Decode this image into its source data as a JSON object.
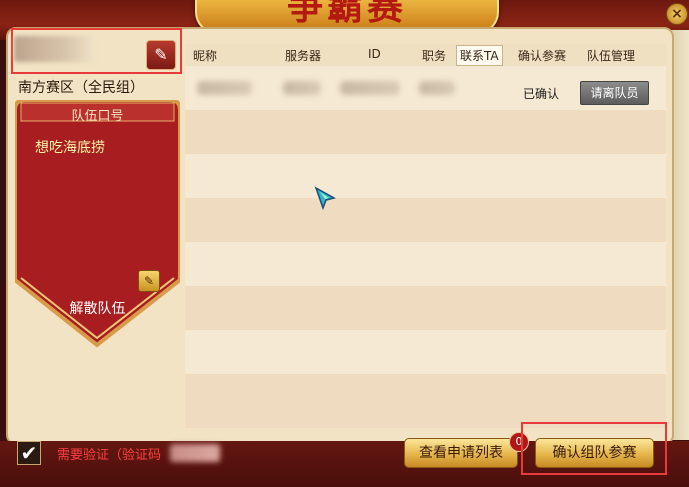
{
  "title": "争霸赛",
  "close_label": "×",
  "region": "南方赛区（全民组）",
  "banner": {
    "title": "队伍口号",
    "motto": "想吃海底捞",
    "disband": "解散队伍"
  },
  "table": {
    "headers": [
      "昵称",
      "服务器",
      "ID",
      "职务",
      "联系TA",
      "确认参赛",
      "队伍管理"
    ],
    "active_header": "联系TA",
    "status": "已确认",
    "kick_label": "请离队员"
  },
  "footer": {
    "verify_label": "需要验证（验证码",
    "apply_list": "查看申请列表",
    "badge": "0",
    "confirm": "确认组队参赛"
  },
  "colors": {
    "accent": "#e83a3a",
    "banner_red": "#a81d1f",
    "gold": "#e5b54c"
  },
  "icons": {
    "edit": "pencil-icon",
    "check": "checkmark-icon",
    "close": "close-icon"
  }
}
